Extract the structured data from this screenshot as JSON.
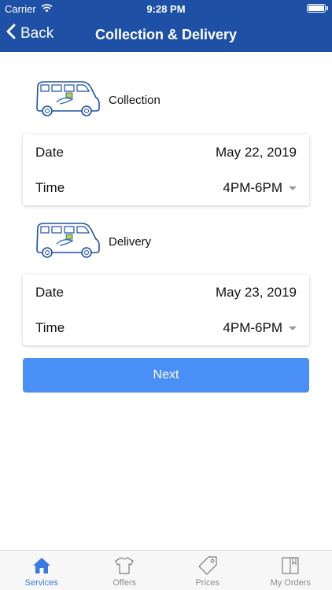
{
  "status": {
    "carrier": "Carrier",
    "time": "9:28 PM"
  },
  "nav": {
    "back_label": "Back",
    "title": "Collection & Delivery"
  },
  "collection": {
    "label": "Collection",
    "date_label": "Date",
    "date_value": "May 22, 2019",
    "time_label": "Time",
    "time_value": "4PM-6PM"
  },
  "delivery": {
    "label": "Delivery",
    "date_label": "Date",
    "date_value": "May 23, 2019",
    "time_label": "Time",
    "time_value": "4PM-6PM"
  },
  "next_label": "Next",
  "tabs": [
    {
      "label": "Services",
      "icon": "home-icon",
      "active": true
    },
    {
      "label": "Offers",
      "icon": "shirt-icon",
      "active": false
    },
    {
      "label": "Prices",
      "icon": "price-tag-icon",
      "active": false
    },
    {
      "label": "My Orders",
      "icon": "book-icon",
      "active": false
    }
  ],
  "colors": {
    "header": "#1e50a6",
    "button": "#4a8ff5",
    "active_tab": "#3a7ae0"
  }
}
